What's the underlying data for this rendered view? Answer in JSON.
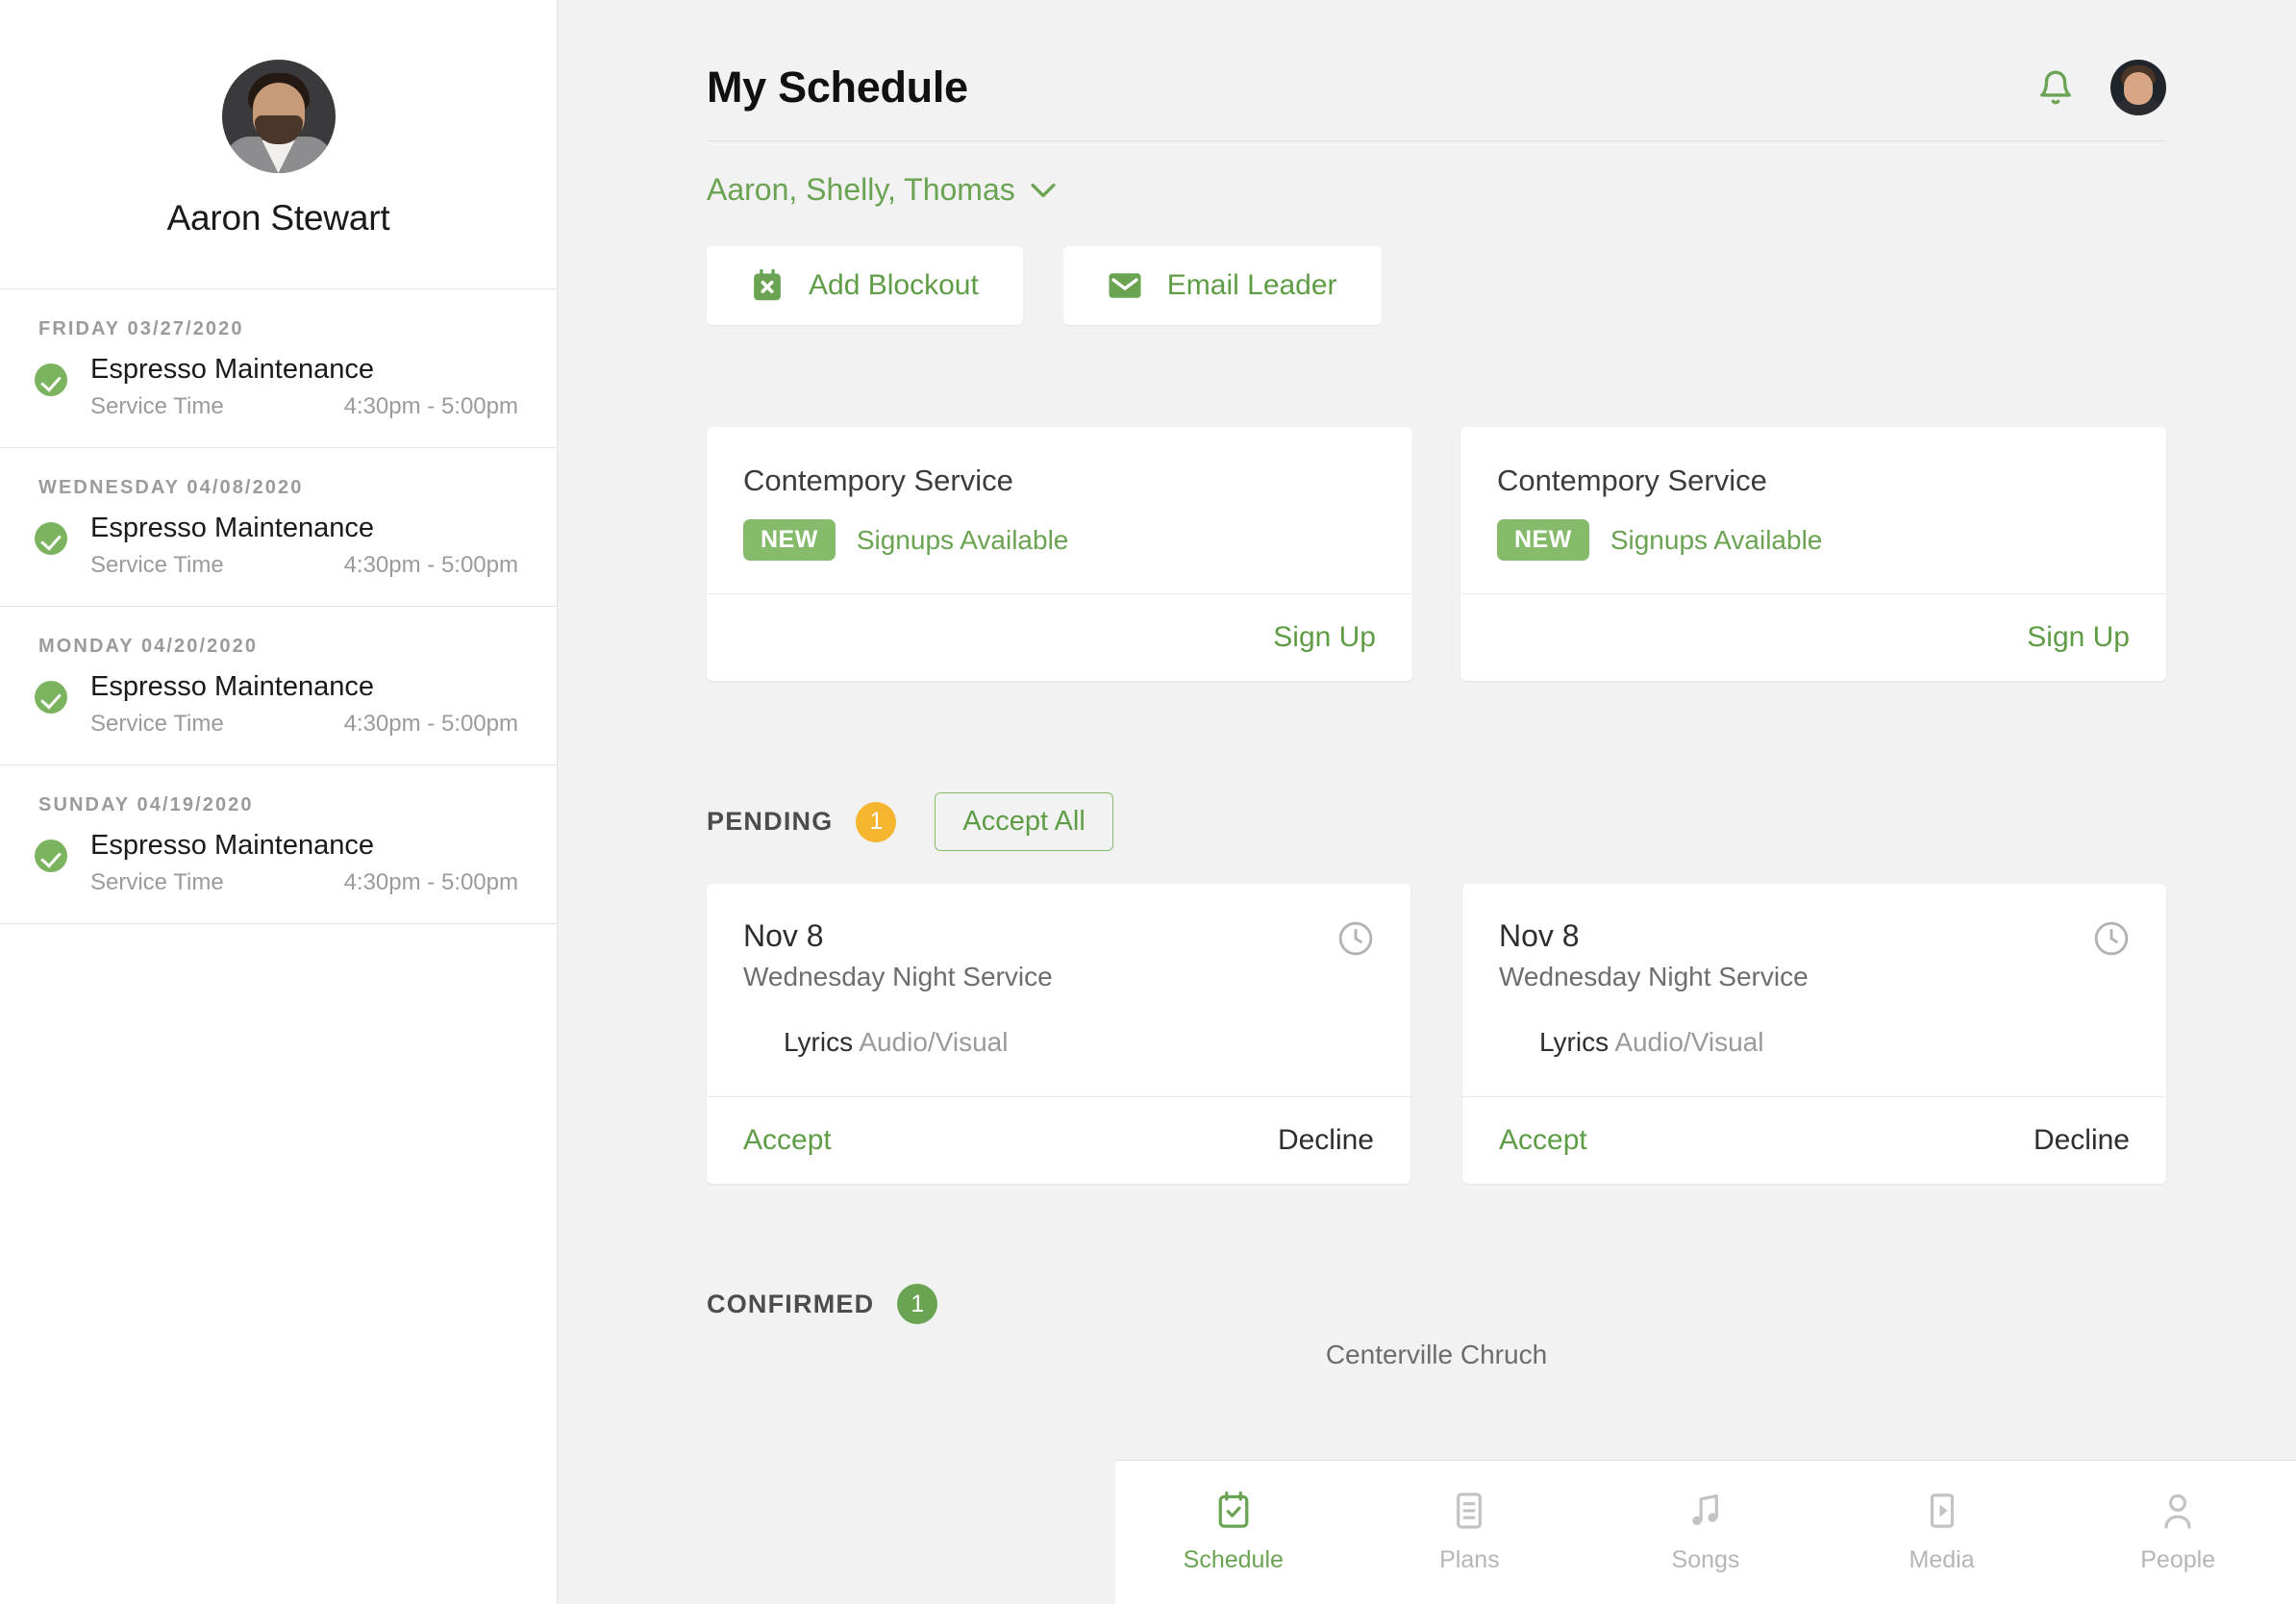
{
  "sidebar": {
    "profile": {
      "name": "Aaron Stewart",
      "avatar_icon": "user-avatar-photo"
    },
    "schedule_groups": [
      {
        "date": "FRIDAY 03/27/2020",
        "title": "Espresso Maintenance",
        "status_icon": "check-circle-icon",
        "meta_label": "Service Time",
        "meta_time": "4:30pm - 5:00pm"
      },
      {
        "date": "WEDNESDAY 04/08/2020",
        "title": "Espresso Maintenance",
        "status_icon": "check-circle-icon",
        "meta_label": "Service Time",
        "meta_time": "4:30pm - 5:00pm"
      },
      {
        "date": "MONDAY 04/20/2020",
        "title": "Espresso Maintenance",
        "status_icon": "check-circle-icon",
        "meta_label": "Service Time",
        "meta_time": "4:30pm - 5:00pm"
      },
      {
        "date": "SUNDAY 04/19/2020",
        "title": "Espresso Maintenance",
        "status_icon": "check-circle-icon",
        "meta_label": "Service Time",
        "meta_time": "4:30pm - 5:00pm"
      }
    ]
  },
  "header": {
    "title": "My Schedule",
    "bell_icon": "notification-bell-icon",
    "avatar_icon": "user-avatar-photo",
    "selector_label": "Aaron, Shelly, Thomas",
    "selector_chevron": "chevron-down-icon"
  },
  "actions": [
    {
      "label": "Add Blockout",
      "icon": "calendar-x-icon"
    },
    {
      "label": "Email Leader",
      "icon": "envelope-icon"
    }
  ],
  "signup_cards": [
    {
      "title": "Contempory Service",
      "badge": "NEW",
      "status": "Signups Available",
      "cta": "Sign Up"
    },
    {
      "title": "Contempory Service",
      "badge": "NEW",
      "status": "Signups Available",
      "cta": "Sign Up"
    }
  ],
  "pending": {
    "label": "PENDING",
    "count": "1",
    "accept_all_label": "Accept All",
    "cards": [
      {
        "date": "Nov 8",
        "service": "Wednesday Night Service",
        "clock_icon": "clock-icon",
        "role": "Lyrics",
        "team": "Audio/Visual",
        "accept": "Accept",
        "decline": "Decline"
      },
      {
        "date": "Nov 8",
        "service": "Wednesday Night Service",
        "clock_icon": "clock-icon",
        "role": "Lyrics",
        "team": "Audio/Visual",
        "accept": "Accept",
        "decline": "Decline"
      }
    ]
  },
  "confirmed": {
    "label": "CONFIRMED",
    "count": "1"
  },
  "org": {
    "name": "Centerville Chruch"
  },
  "bottom_nav": [
    {
      "label": "Schedule",
      "icon": "calendar-check-icon",
      "active": true
    },
    {
      "label": "Plans",
      "icon": "document-lines-icon",
      "active": false
    },
    {
      "label": "Songs",
      "icon": "music-note-icon",
      "active": false
    },
    {
      "label": "Media",
      "icon": "play-rectangle-icon",
      "active": false
    },
    {
      "label": "People",
      "icon": "person-icon",
      "active": false
    }
  ],
  "colors": {
    "accent_green": "#6aa352",
    "badge_green": "#86bb6b",
    "badge_amber": "#f5b52e",
    "bg_gray": "#f2f2f2"
  }
}
